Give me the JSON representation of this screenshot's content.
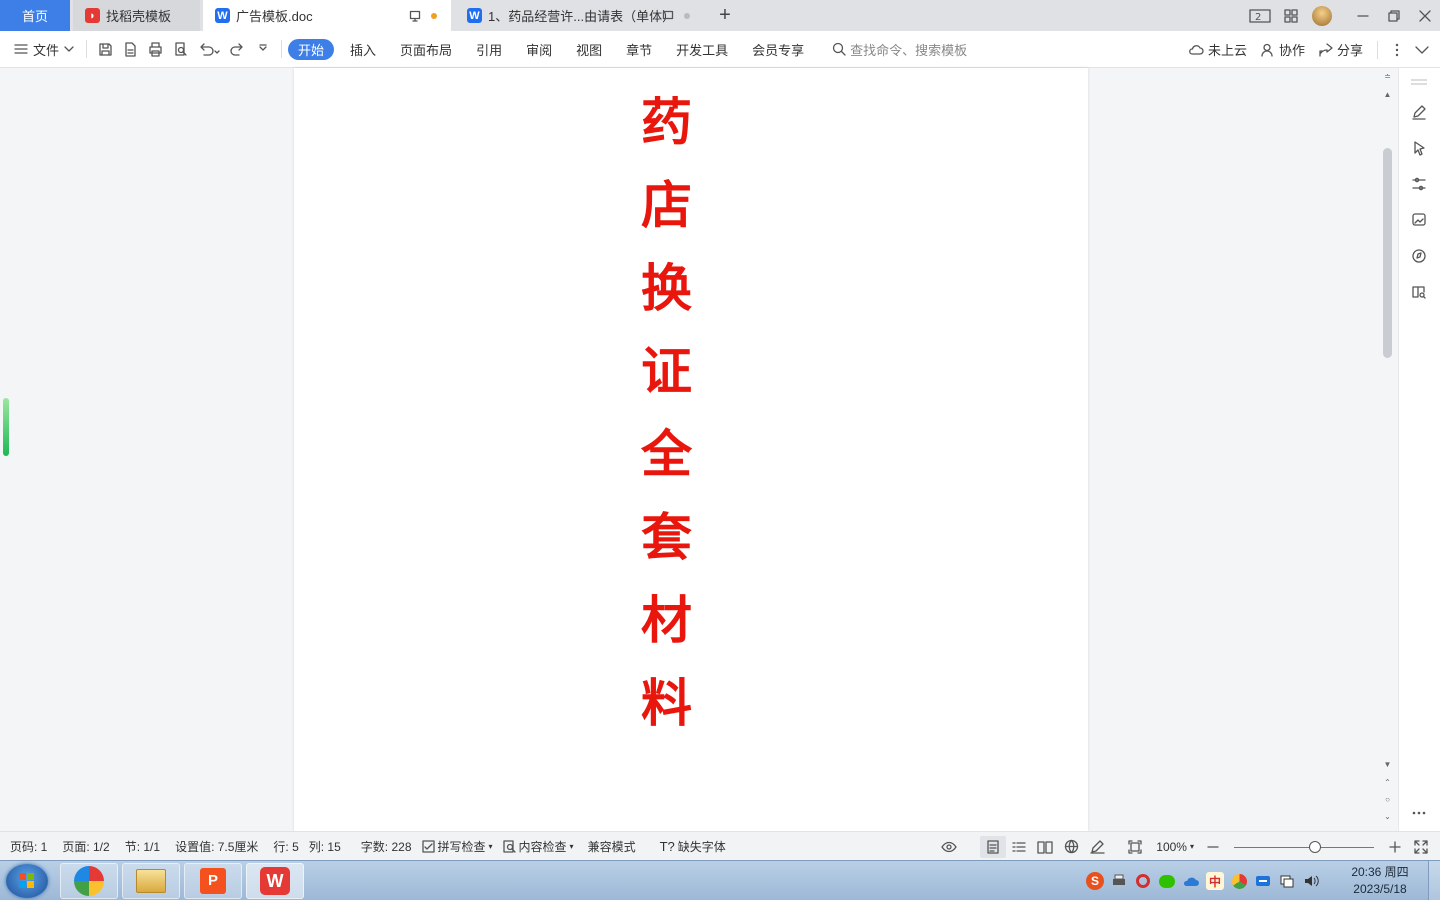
{
  "tabs": {
    "home": "首页",
    "templates": "找稻壳模板",
    "active_doc": "广告模板.doc",
    "doc2": "1、药品经营许...由请表（单体）",
    "new_tab": "+"
  },
  "ribbon": {
    "file": "文件",
    "menu": [
      "开始",
      "插入",
      "页面布局",
      "引用",
      "审阅",
      "视图",
      "章节",
      "开发工具",
      "会员专享"
    ],
    "search_placeholder": "查找命令、搜索模板",
    "cloud": "未上云",
    "collab": "协作",
    "share": "分享"
  },
  "document": {
    "title_chars": [
      "药",
      "店",
      "换",
      "证",
      "全",
      "套",
      "材",
      "料"
    ],
    "title_color": "#e8160c"
  },
  "status": {
    "page_code": "页码: 1",
    "pages": "页面: 1/2",
    "section": "节: 1/1",
    "setting": "设置值: 7.5厘米",
    "row": "行: 5",
    "col": "列: 15",
    "word_count": "字数: 228",
    "spell_check": "拼写检查",
    "content_check": "内容检查",
    "compat_mode": "兼容模式",
    "missing_fonts": "缺失字体",
    "zoom": "100%",
    "zoom_level": 100
  },
  "taskbar": {
    "time": "20:36 周四",
    "date": "2023/5/18",
    "ime": "中"
  },
  "colors": {
    "accent": "#3d7fe6",
    "wps_red": "#e53935"
  }
}
